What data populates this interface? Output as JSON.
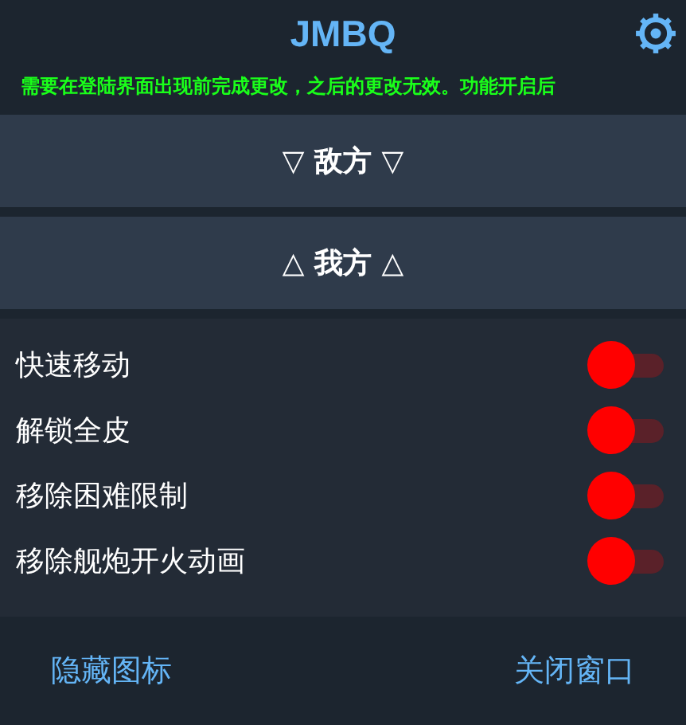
{
  "header": {
    "title": "JMBQ",
    "notice": "需要在登陆界面出现前完成更改，之后的更改无效。功能开启后"
  },
  "sections": [
    {
      "label": "▽ 敌方 ▽"
    },
    {
      "label": "△ 我方 △",
      "items": [
        {
          "label": "快速移动",
          "checked": false
        },
        {
          "label": "解锁全皮",
          "checked": false
        },
        {
          "label": "移除困难限制",
          "checked": false
        },
        {
          "label": "移除舰炮开火动画",
          "checked": false
        }
      ]
    }
  ],
  "buttons": [
    "隐藏图标",
    "关闭窗口"
  ]
}
